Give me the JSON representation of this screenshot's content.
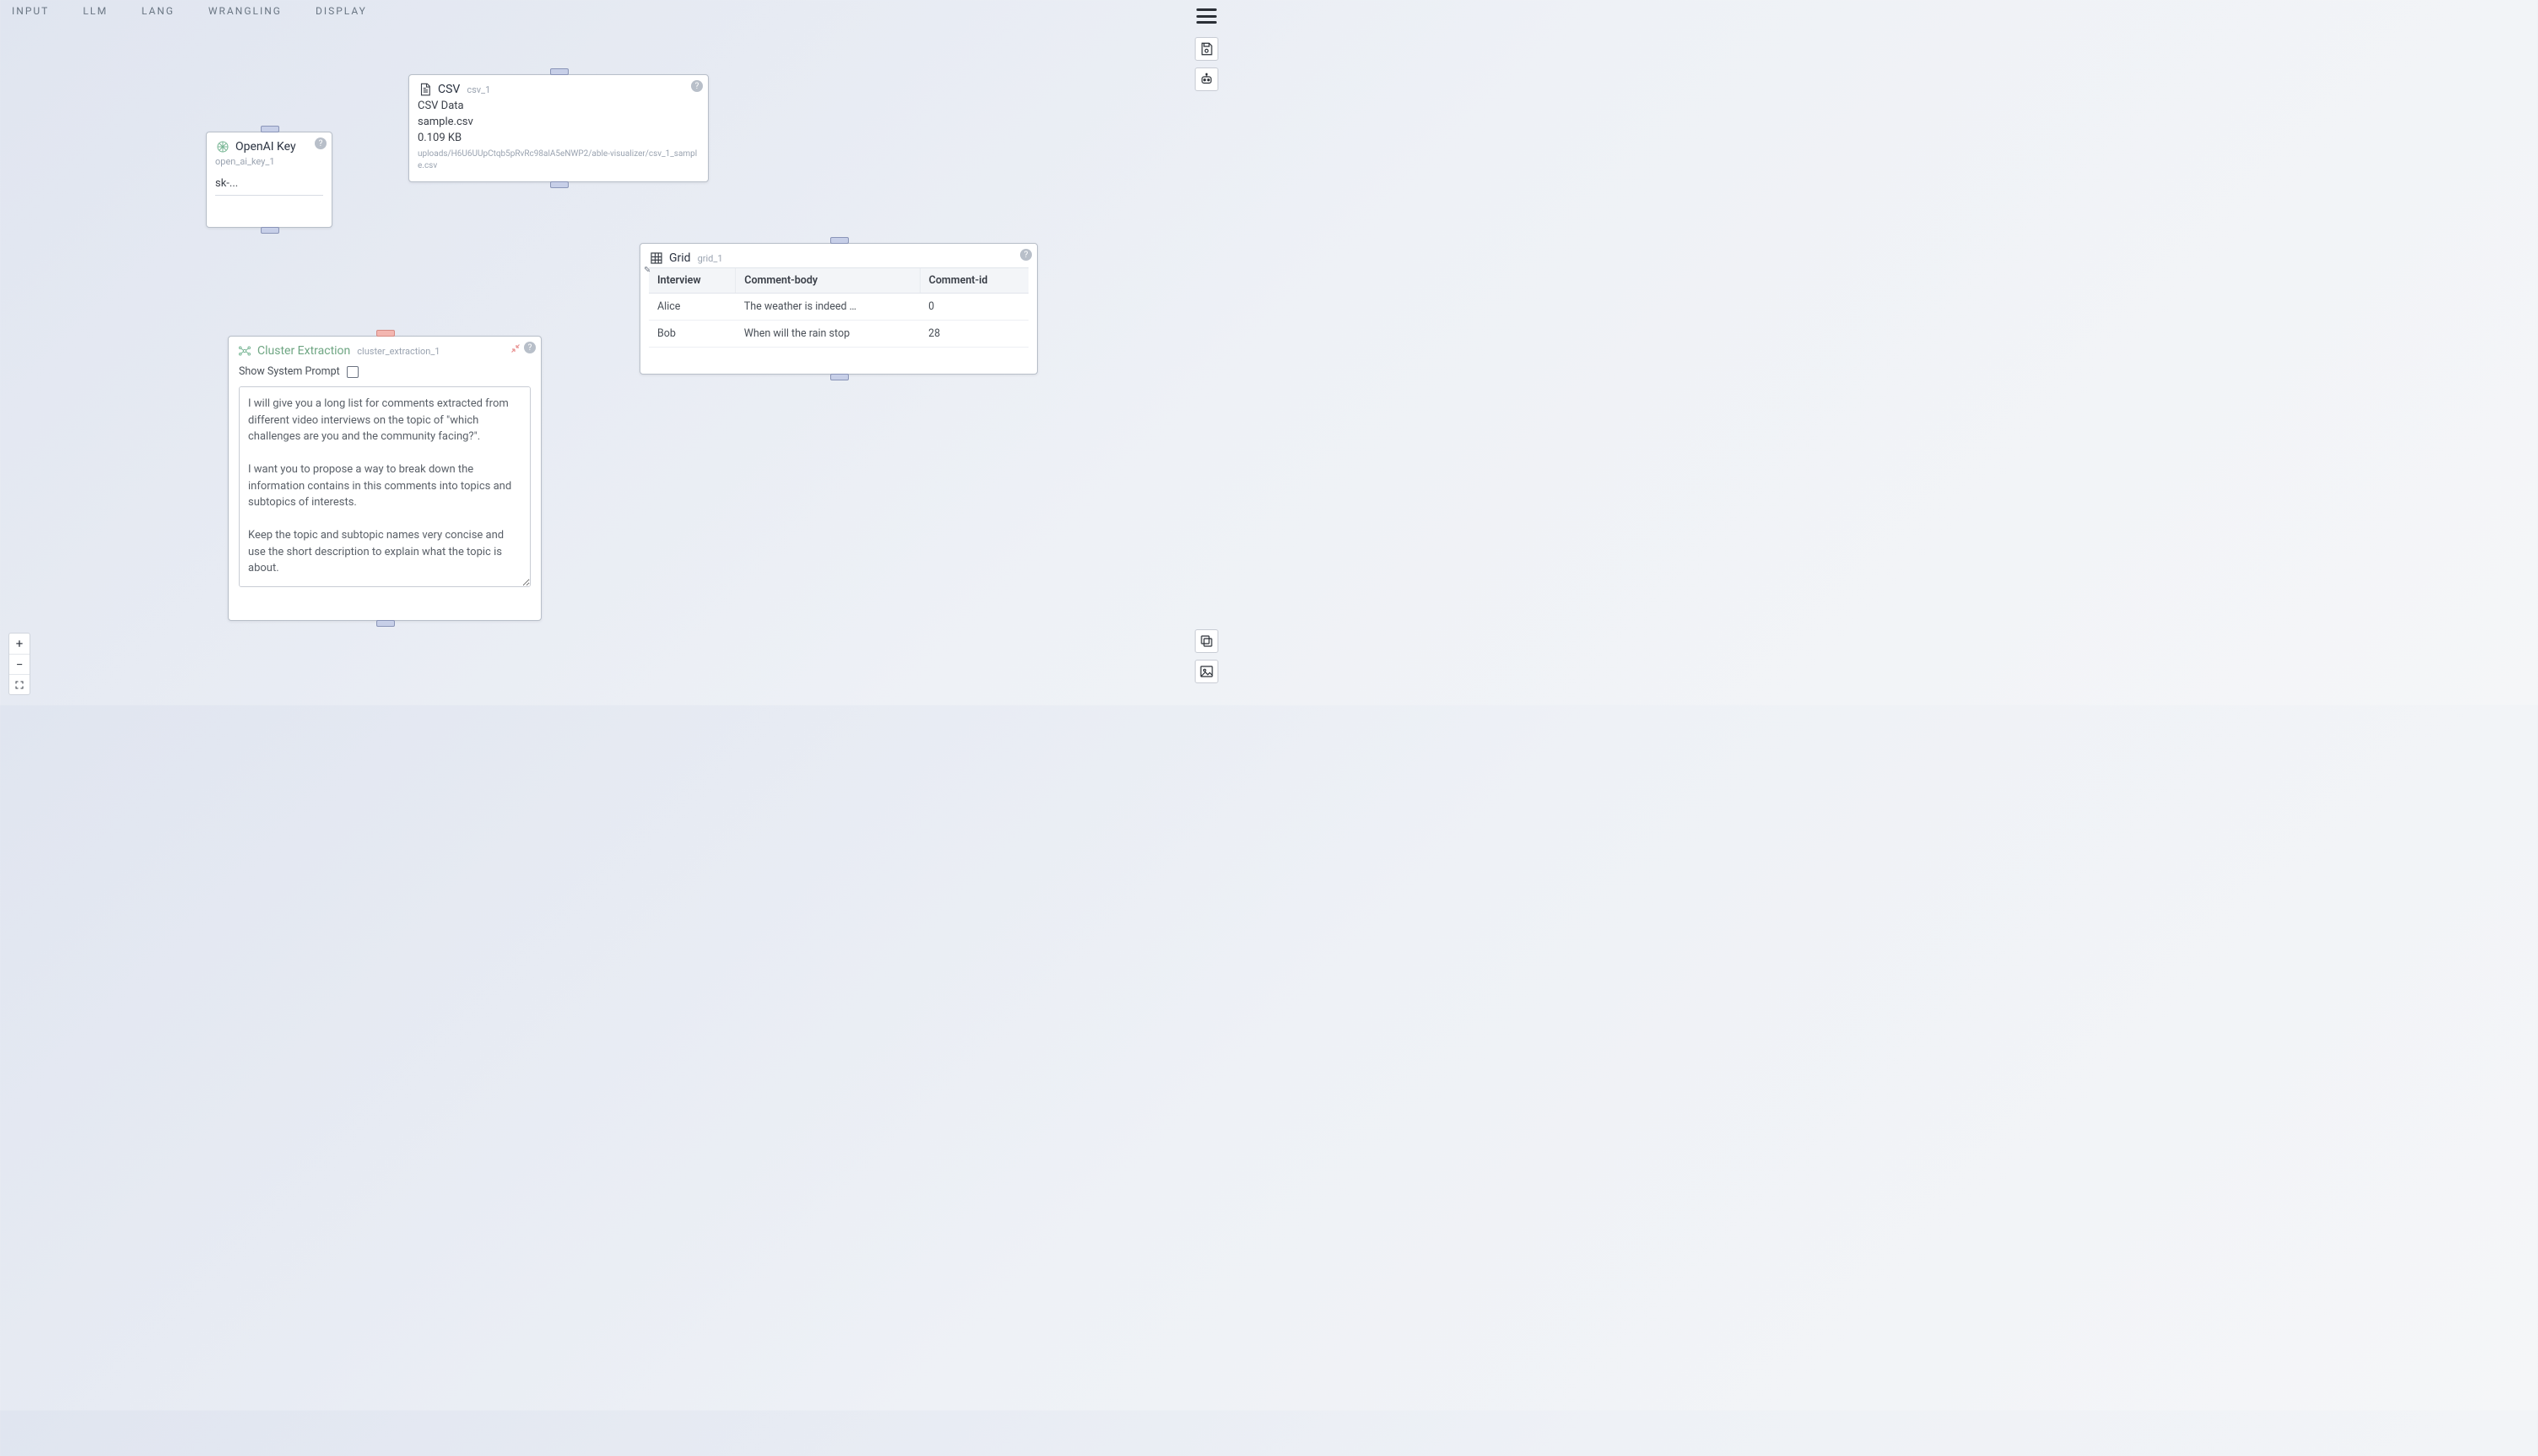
{
  "menu": {
    "input": "INPUT",
    "llm": "LLM",
    "lang": "LANG",
    "wrangling": "WRANGLING",
    "display": "DISPLAY"
  },
  "nodes": {
    "openai": {
      "title": "OpenAI Key",
      "id": "open_ai_key_1",
      "value": "sk-..."
    },
    "csv": {
      "title": "CSV",
      "id": "csv_1",
      "line1": "CSV Data",
      "line2": "sample.csv",
      "line3": "0.109 KB",
      "path": "uploads/H6U6UUpCtqb5pRvRc98alA5eNWP2/able-visualizer/csv_1_sample.csv"
    },
    "grid": {
      "title": "Grid",
      "id": "grid_1",
      "columns": [
        "Interview",
        "Comment-body",
        "Comment-id"
      ],
      "rows": [
        {
          "c0": "Alice",
          "c1": "The weather is indeed …",
          "c2": "0"
        },
        {
          "c0": "Bob",
          "c1": "When will the rain stop",
          "c2": "28"
        }
      ]
    },
    "cluster": {
      "title": "Cluster Extraction",
      "id": "cluster_extraction_1",
      "show_system_prompt_label": "Show System Prompt",
      "prompt": "I will give you a long list for comments extracted from different video interviews on the topic of \"which challenges are you and the community facing?\".\n\nI want you to propose a way to break down the information contains in this comments into topics and subtopics of interests.\n\nKeep the topic and subtopic names very concise and use the short description to explain what the topic is about.\n\nReturn a JSON object of the form {"
    }
  }
}
